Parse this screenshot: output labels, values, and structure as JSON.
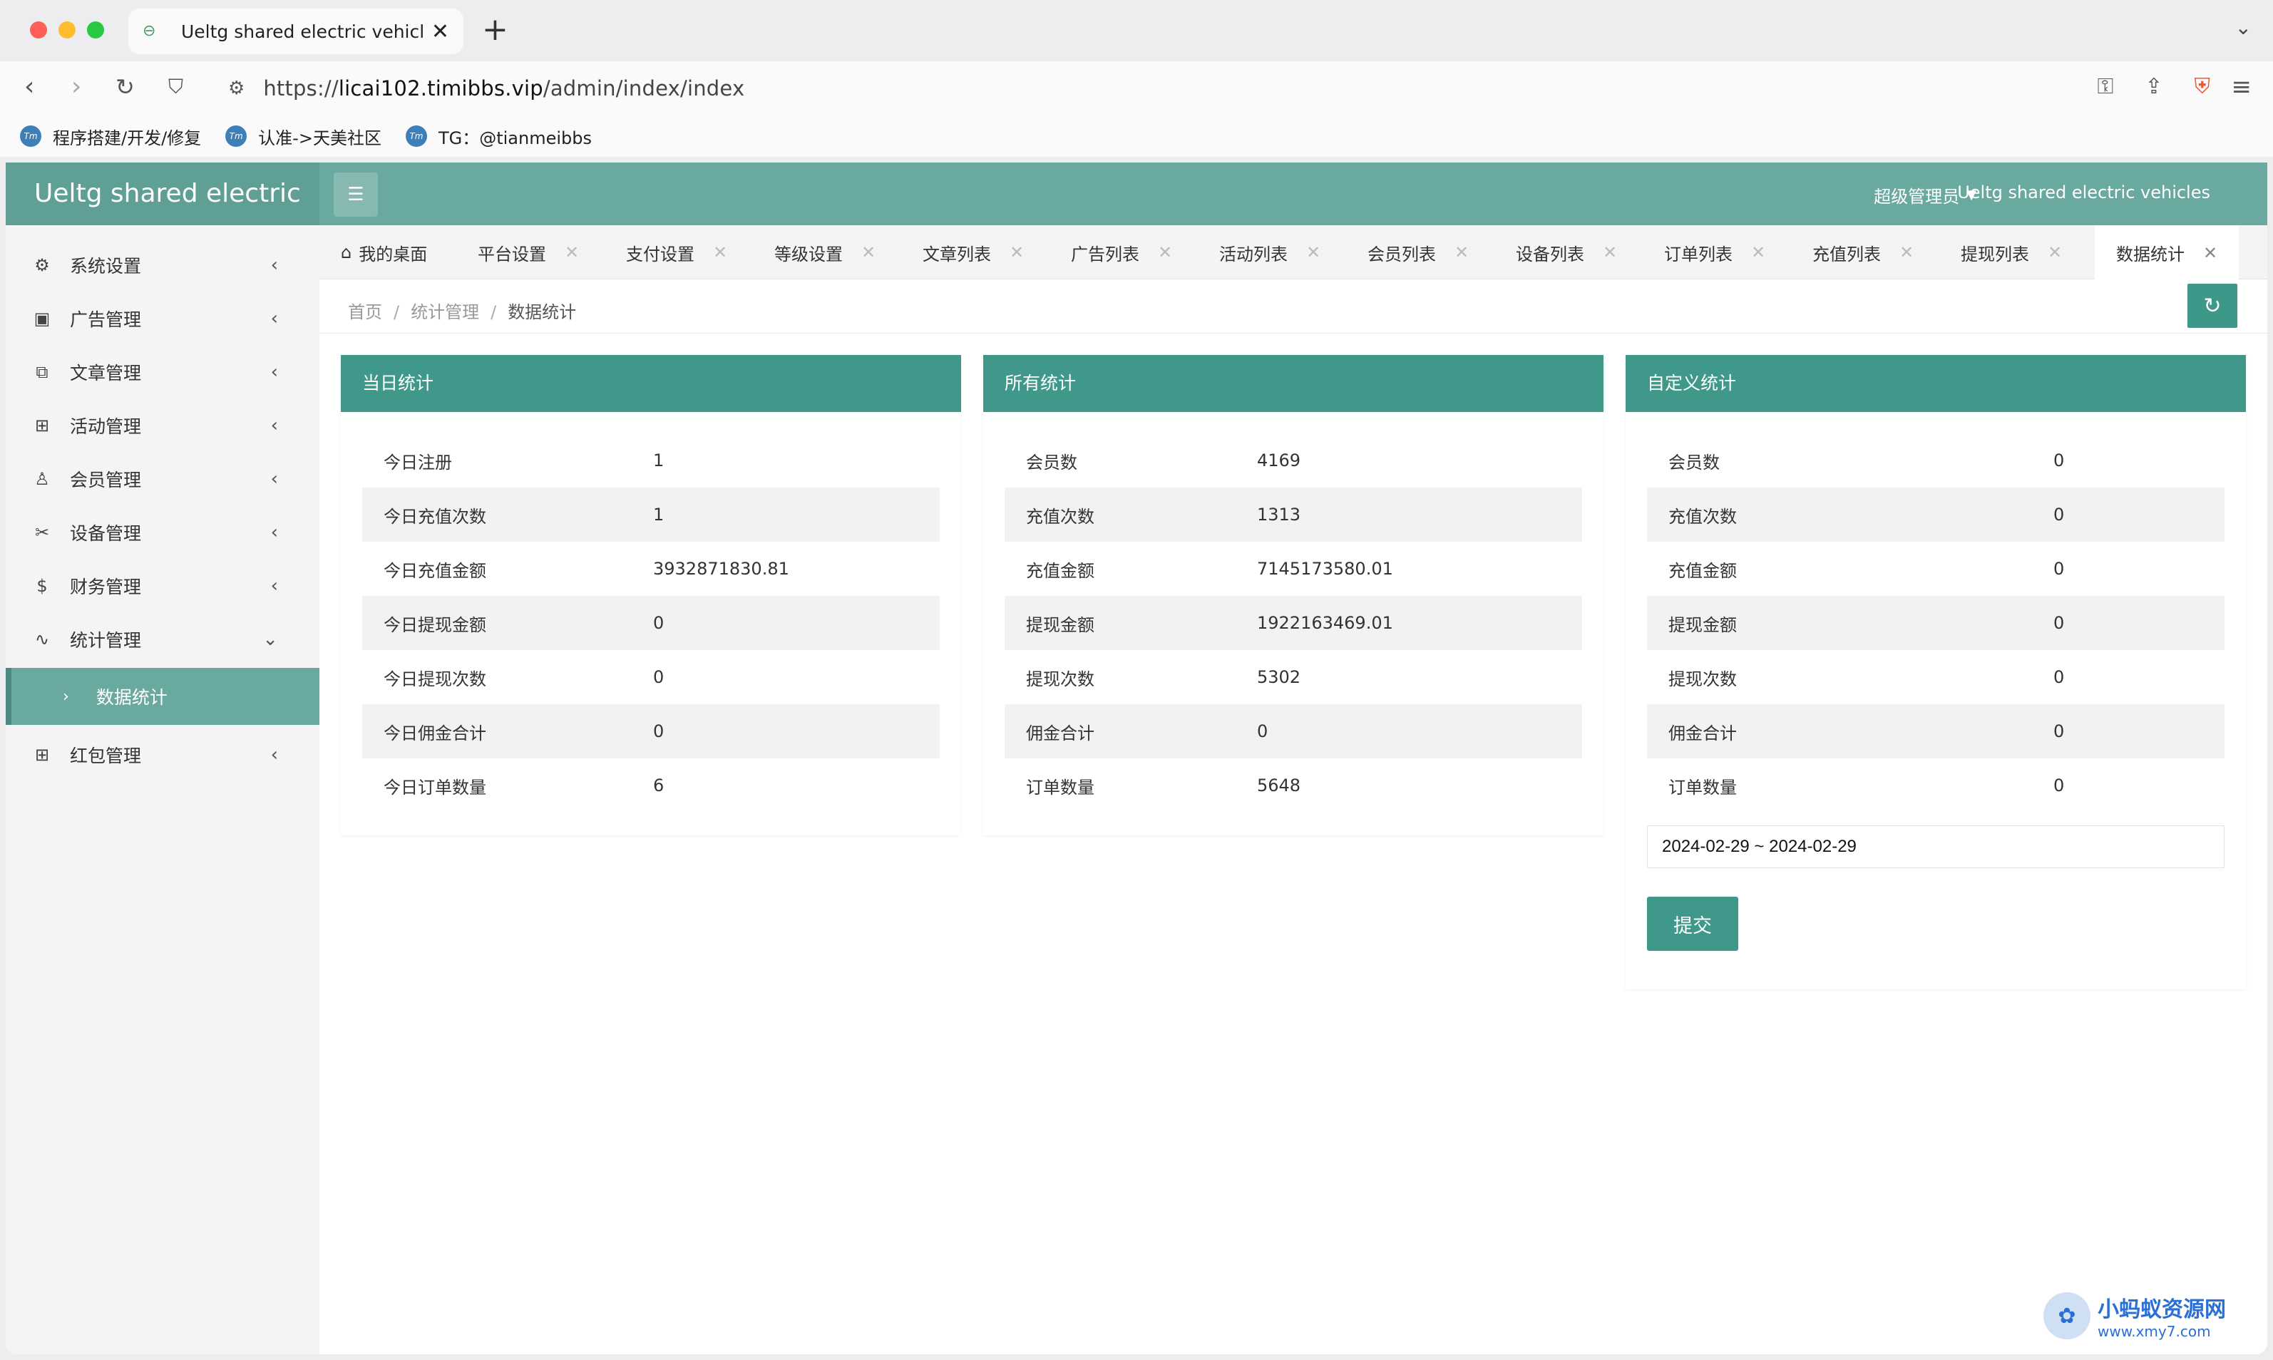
{
  "browser": {
    "tab_title": "Ueltg shared electric vehicles",
    "tab_close": "✕",
    "new_tab": "+",
    "url_prefix": "https://",
    "url_host": "licai102.timibbs.vip",
    "url_path": "/admin/index/index",
    "bookmarks": [
      {
        "icon": "Tm",
        "label": "程序搭建/开发/修复"
      },
      {
        "icon": "Tm",
        "label": "认准->天美社区"
      },
      {
        "icon": "Tm",
        "label": "TG：@tianmeibbs"
      }
    ]
  },
  "header": {
    "logo": "Ueltg shared electric",
    "admin_label": "超级管理员",
    "site_name": "Ueltg shared electric vehicles"
  },
  "sidebar": {
    "items": [
      {
        "icon": "gear-icon",
        "label": "系统设置"
      },
      {
        "icon": "image-icon",
        "label": "广告管理"
      },
      {
        "icon": "book-icon",
        "label": "文章管理"
      },
      {
        "icon": "gift-icon",
        "label": "活动管理"
      },
      {
        "icon": "user-icon",
        "label": "会员管理"
      },
      {
        "icon": "tools-icon",
        "label": "设备管理"
      },
      {
        "icon": "dollar-icon",
        "label": "财务管理"
      },
      {
        "icon": "pulse-icon",
        "label": "统计管理"
      }
    ],
    "sub_item": "数据统计",
    "last_item": {
      "icon": "gift-icon",
      "label": "红包管理"
    }
  },
  "page_tabs": [
    {
      "label": "我的桌面"
    },
    {
      "label": "平台设置"
    },
    {
      "label": "支付设置"
    },
    {
      "label": "等级设置"
    },
    {
      "label": "文章列表"
    },
    {
      "label": "广告列表"
    },
    {
      "label": "活动列表"
    },
    {
      "label": "会员列表"
    },
    {
      "label": "设备列表"
    },
    {
      "label": "订单列表"
    },
    {
      "label": "充值列表"
    },
    {
      "label": "提现列表"
    },
    {
      "label": "数据统计"
    }
  ],
  "breadcrumb": {
    "home": "首页",
    "section": "统计管理",
    "current": "数据统计",
    "separator": "/"
  },
  "cards": {
    "today": {
      "title": "当日统计",
      "rows": [
        {
          "label": "今日注册",
          "value": "1"
        },
        {
          "label": "今日充值次数",
          "value": "1"
        },
        {
          "label": "今日充值金额",
          "value": "3932871830.81"
        },
        {
          "label": "今日提现金额",
          "value": "0"
        },
        {
          "label": "今日提现次数",
          "value": "0"
        },
        {
          "label": "今日佣金合计",
          "value": "0"
        },
        {
          "label": "今日订单数量",
          "value": "6"
        }
      ]
    },
    "all": {
      "title": "所有统计",
      "rows": [
        {
          "label": "会员数",
          "value": "4169"
        },
        {
          "label": "充值次数",
          "value": "1313"
        },
        {
          "label": "充值金额",
          "value": "7145173580.01"
        },
        {
          "label": "提现金额",
          "value": "1922163469.01"
        },
        {
          "label": "提现次数",
          "value": "5302"
        },
        {
          "label": "佣金合计",
          "value": "0"
        },
        {
          "label": "订单数量",
          "value": "5648"
        }
      ]
    },
    "custom": {
      "title": "自定义统计",
      "rows": [
        {
          "label": "会员数",
          "value": "0"
        },
        {
          "label": "充值次数",
          "value": "0"
        },
        {
          "label": "充值金额",
          "value": "0"
        },
        {
          "label": "提现金额",
          "value": "0"
        },
        {
          "label": "提现次数",
          "value": "0"
        },
        {
          "label": "佣金合计",
          "value": "0"
        },
        {
          "label": "订单数量",
          "value": "0"
        }
      ],
      "date_range": "2024-02-29 ~ 2024-02-29",
      "submit_label": "提交"
    }
  },
  "watermark": {
    "title": "小蚂蚁资源网",
    "url": "www.xmy7.com"
  },
  "colors": {
    "header": "#6aa9a0",
    "accent": "#3f988a",
    "sidebar": "#f4f4f4"
  }
}
